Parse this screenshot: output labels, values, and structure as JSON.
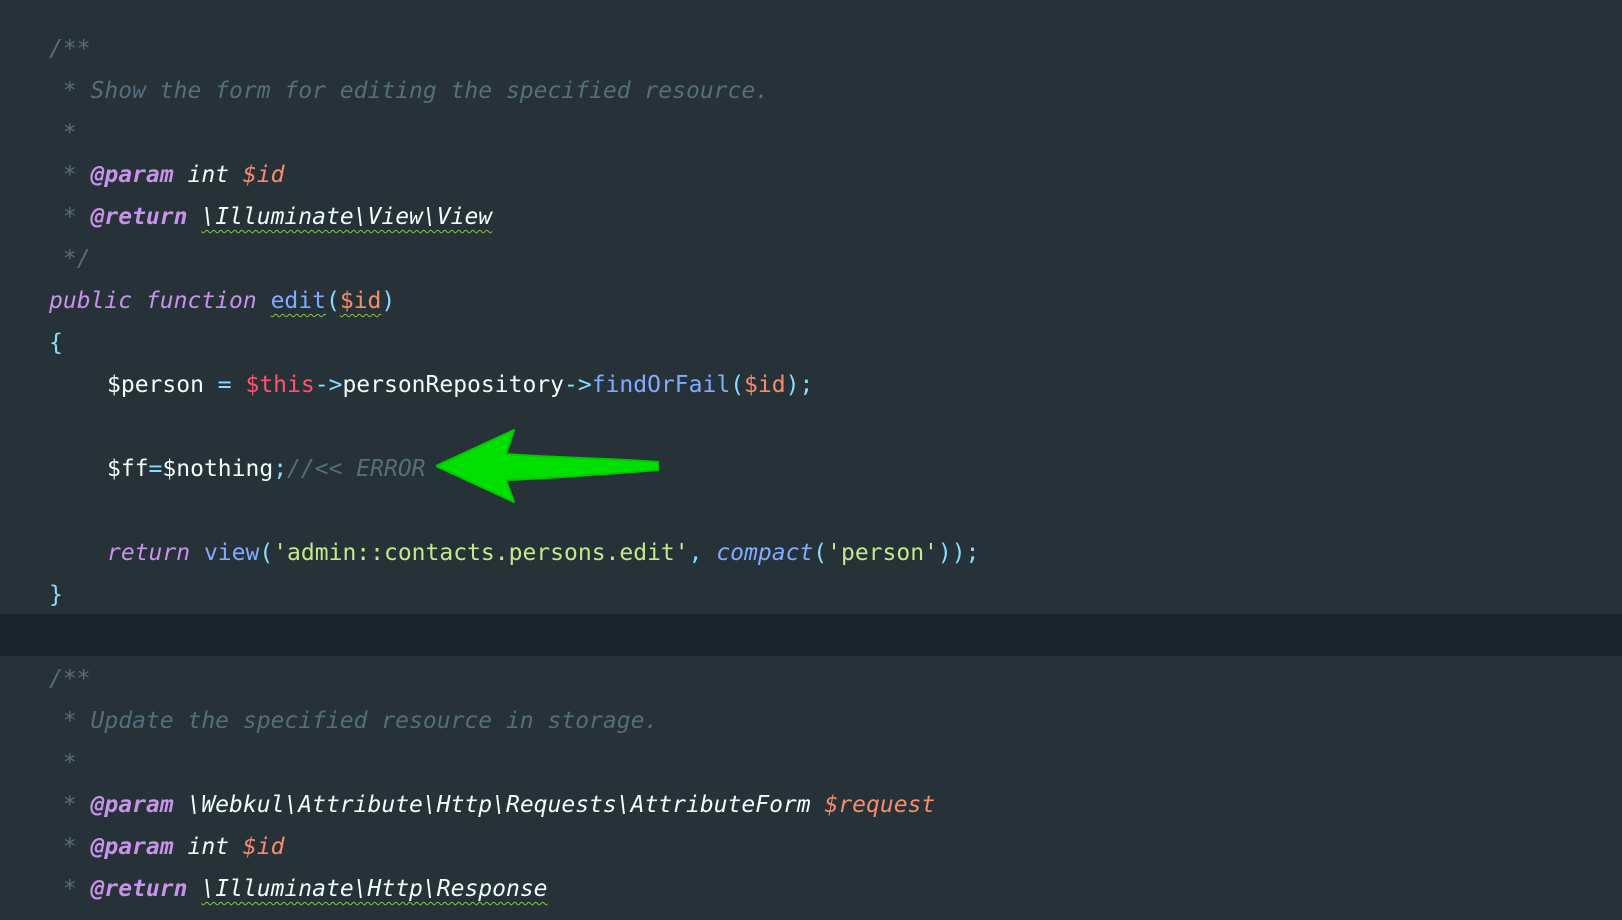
{
  "editor": {
    "theme_colors": {
      "background": "#263238",
      "current_line": "#1b252b",
      "comment": "#546e7a",
      "keyword": "#c792ea",
      "function": "#82aaff",
      "punctuation": "#89ddff",
      "variable": "#f78c6c",
      "this": "#ff5370",
      "string": "#c3e88d",
      "annotation_arrow": "#00e000"
    },
    "lines": {
      "l1": {
        "open": "/**"
      },
      "l2": {
        "text": " * Show the form for editing the specified resource."
      },
      "l3": {
        "text": " *"
      },
      "l4": {
        "star": " * ",
        "tag": "@param",
        "type": " int ",
        "var": "$id"
      },
      "l5": {
        "star": " * ",
        "tag": "@return",
        "sp": " ",
        "type": "\\Illuminate\\View\\View"
      },
      "l6": {
        "text": " */"
      },
      "l7": {
        "kw": "public function ",
        "name": "edit",
        "lp": "(",
        "arg": "$id",
        "rp": ")"
      },
      "l8": {
        "text": "{"
      },
      "l9": {
        "var": "$person",
        "eq": " = ",
        "this": "$this",
        "arrow1": "->",
        "prop": "personRepository",
        "arrow2": "->",
        "method": "findOrFail",
        "lp": "(",
        "arg": "$id",
        "rp": ");"
      },
      "l11": {
        "var": "$ff",
        "eq": "=",
        "val": "$nothing",
        "semi": ";",
        "comment": "//<< ERROR"
      },
      "l13": {
        "kw": "return",
        "sp": " ",
        "func": "view",
        "lp": "(",
        "str1": "'admin::contacts.persons.edit'",
        "comma": ", ",
        "func2": "compact",
        "lp2": "(",
        "str2": "'person'",
        "rp": "));"
      },
      "l14": {
        "text": "}"
      },
      "l16": {
        "open": "/**"
      },
      "l17": {
        "text": " * Update the specified resource in storage."
      },
      "l18": {
        "text": " *"
      },
      "l19": {
        "star": " * ",
        "tag": "@param",
        "type": " \\Webkul\\Attribute\\Http\\Requests\\AttributeForm ",
        "var": "$request"
      },
      "l20": {
        "star": " * ",
        "tag": "@param",
        "type": " int ",
        "var": "$id"
      },
      "l21": {
        "star": " * ",
        "tag": "@return",
        "sp": " ",
        "type": "\\Illuminate\\Http\\Response"
      }
    }
  }
}
